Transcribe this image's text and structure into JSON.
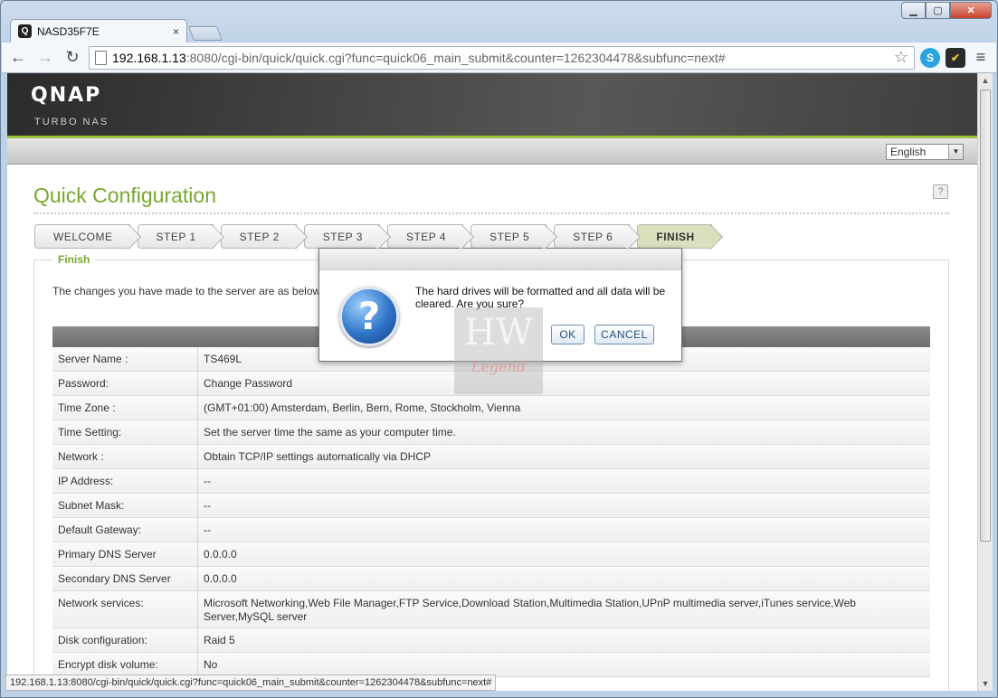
{
  "browser": {
    "tab_title": "NASD35F7E",
    "tab_favicon": "Q",
    "tab_close": "×",
    "url_host": "192.168.1.13",
    "url_rest": ":8080/cgi-bin/quick/quick.cgi?func=quick06_main_submit&counter=1262304478&subfunc=next#",
    "status_url": "192.168.1.13:8080/cgi-bin/quick/quick.cgi?func=quick06_main_submit&counter=1262304478&subfunc=next#",
    "icons": [
      "back-icon",
      "forward-icon",
      "reload-icon",
      "page-icon",
      "star-icon",
      "skype-icon",
      "checkmark-extension-icon",
      "menu-icon"
    ]
  },
  "header": {
    "logo": "QNAP",
    "tagline": "Turbo NAS",
    "language": "English"
  },
  "page": {
    "title": "Quick Configuration",
    "steps": [
      "WELCOME",
      "STEP 1",
      "STEP 2",
      "STEP 3",
      "STEP 4",
      "STEP 5",
      "STEP 6",
      "FINISH"
    ],
    "active_step": "FINISH",
    "section_legend": "Finish",
    "intro": "The changes you have made to the server are as below. ... o return to the previous steps to modify the settings.",
    "summary": [
      {
        "label": "Server Name :",
        "value": "TS469L"
      },
      {
        "label": "Password:",
        "value": "Change Password"
      },
      {
        "label": "Time Zone :",
        "value": "(GMT+01:00) Amsterdam, Berlin, Bern, Rome, Stockholm, Vienna"
      },
      {
        "label": "Time Setting:",
        "value": "Set the server time the same as your computer time."
      },
      {
        "label": "Network :",
        "value": "Obtain TCP/IP settings automatically via DHCP"
      },
      {
        "label": "IP Address:",
        "value": "--"
      },
      {
        "label": "Subnet Mask:",
        "value": "--"
      },
      {
        "label": "Default Gateway:",
        "value": "--"
      },
      {
        "label": "Primary DNS Server",
        "value": "0.0.0.0"
      },
      {
        "label": "Secondary DNS Server",
        "value": "0.0.0.0"
      },
      {
        "label": "Network services:",
        "value": "Microsoft Networking,Web File Manager,FTP Service,Download Station,Multimedia Station,UPnP multimedia server,iTunes service,Web Server,MySQL server"
      },
      {
        "label": "Disk configuration:",
        "value": "Raid 5"
      },
      {
        "label": "Encrypt disk volume:",
        "value": "No"
      }
    ]
  },
  "dialog": {
    "message": "The hard drives will be formatted and all data will be cleared. Are you sure?",
    "ok_label": "OK",
    "cancel_label": "CANCEL"
  },
  "watermark": {
    "text": "HW",
    "sub": "Legend"
  },
  "colors": {
    "brand_green": "#76a82c",
    "header_dark": "#3f3e3d",
    "active_step": "#d8e0be"
  }
}
